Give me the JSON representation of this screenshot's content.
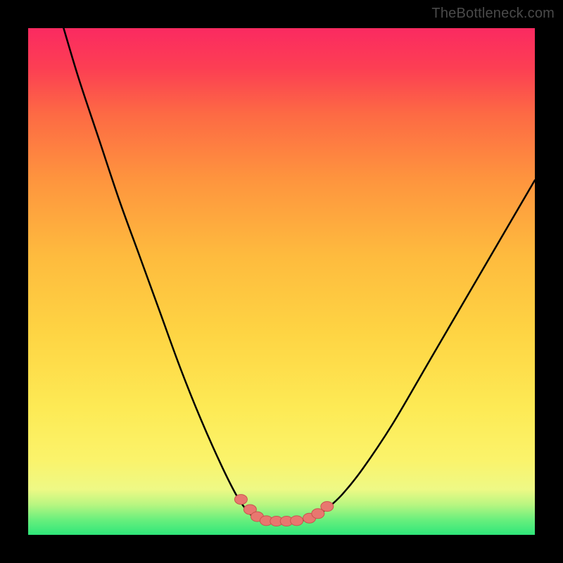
{
  "attribution": "TheBottleneck.com",
  "chart_data": {
    "type": "line",
    "title": "",
    "xlabel": "",
    "ylabel": "",
    "xlim": [
      0,
      100
    ],
    "ylim": [
      0,
      100
    ],
    "series": [
      {
        "name": "curve-left",
        "x": [
          7,
          10,
          14,
          18,
          22,
          26,
          30,
          34,
          38,
          41,
          43,
          44.5,
          45.5
        ],
        "y": [
          100,
          90,
          78,
          66,
          55,
          44,
          33,
          23,
          14,
          8,
          5,
          3.5,
          3
        ]
      },
      {
        "name": "curve-right",
        "x": [
          55.5,
          57,
          59,
          62,
          66,
          72,
          79,
          86,
          93,
          100
        ],
        "y": [
          3,
          3.8,
          5.2,
          8,
          13,
          22,
          34,
          46,
          58,
          70
        ]
      },
      {
        "name": "valley-flat",
        "x": [
          45.5,
          47,
          49,
          51,
          53,
          55.5
        ],
        "y": [
          3,
          2.8,
          2.7,
          2.7,
          2.8,
          3
        ]
      }
    ],
    "markers": [
      {
        "name": "marker-left-upper",
        "x": 42,
        "y": 7.0
      },
      {
        "name": "marker-left-mid",
        "x": 43.8,
        "y": 5.0
      },
      {
        "name": "marker-left-lower",
        "x": 45.2,
        "y": 3.6
      },
      {
        "name": "marker-valley-1",
        "x": 47,
        "y": 2.8
      },
      {
        "name": "marker-valley-2",
        "x": 49,
        "y": 2.7
      },
      {
        "name": "marker-valley-3",
        "x": 51,
        "y": 2.7
      },
      {
        "name": "marker-valley-4",
        "x": 53,
        "y": 2.8
      },
      {
        "name": "marker-right-lower",
        "x": 55.5,
        "y": 3.3
      },
      {
        "name": "marker-right-mid",
        "x": 57.2,
        "y": 4.2
      },
      {
        "name": "marker-right-upper",
        "x": 59,
        "y": 5.6
      }
    ],
    "colors": {
      "curve": "#000000",
      "marker_fill": "#e8776f",
      "marker_stroke": "#c9554e"
    }
  }
}
